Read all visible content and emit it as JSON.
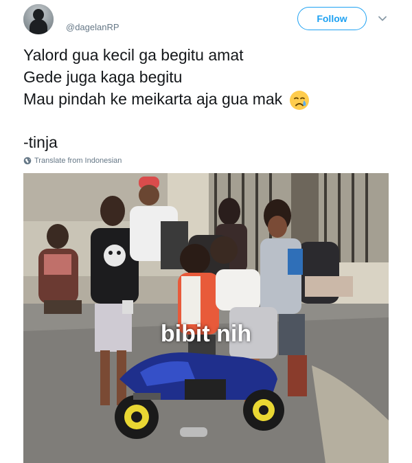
{
  "tweet": {
    "handle": "@dagelanRP",
    "follow_label": "Follow",
    "lines": [
      "Yalord gua kecil ga begitu amat",
      "Gede juga kaga begitu",
      "Mau pindah ke meikarta aja gua mak"
    ],
    "emoji": "crying-face",
    "signoff": "-tinja",
    "translate_label": "Translate from Indonesian"
  },
  "media": {
    "caption": "bibit nih"
  },
  "colors": {
    "accent": "#1da1f2",
    "secondary_text": "#657786",
    "text": "#14171a"
  }
}
